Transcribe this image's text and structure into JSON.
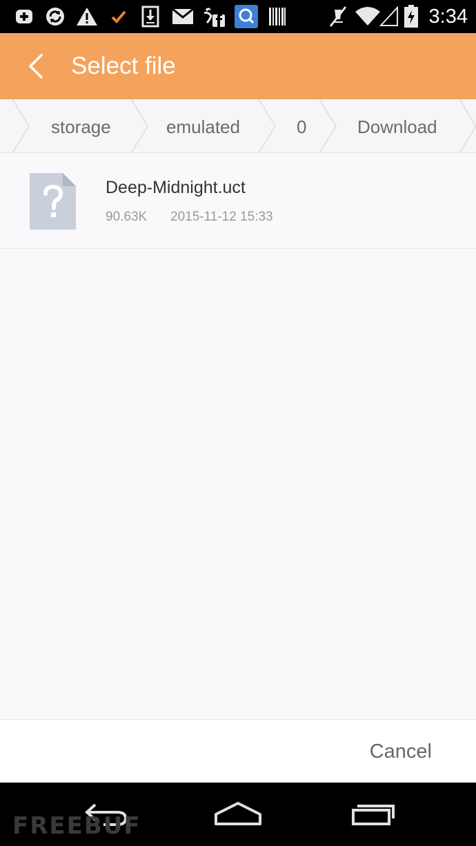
{
  "status_bar": {
    "time": "3:34",
    "icons": [
      "plus-box-icon",
      "sync-icon",
      "warning-icon",
      "check-icon",
      "download-icon",
      "mail-icon",
      "facebook-icon",
      "search-app-icon",
      "barcode-icon",
      "muted-icon",
      "wifi-icon",
      "signal-icon",
      "battery-icon"
    ]
  },
  "action_bar": {
    "title": "Select file",
    "color": "#f5a35c"
  },
  "breadcrumb": {
    "items": [
      "storage",
      "emulated",
      "0",
      "Download"
    ]
  },
  "files": [
    {
      "name": "Deep-Midnight.uct",
      "size": "90.63K",
      "date": "2015-11-12 15:33",
      "icon": "unknown-file-icon"
    }
  ],
  "footer": {
    "cancel_label": "Cancel"
  },
  "nav_bar": {
    "icons": [
      "back-icon",
      "home-icon",
      "recents-icon"
    ],
    "watermark": "FREEBUF"
  }
}
